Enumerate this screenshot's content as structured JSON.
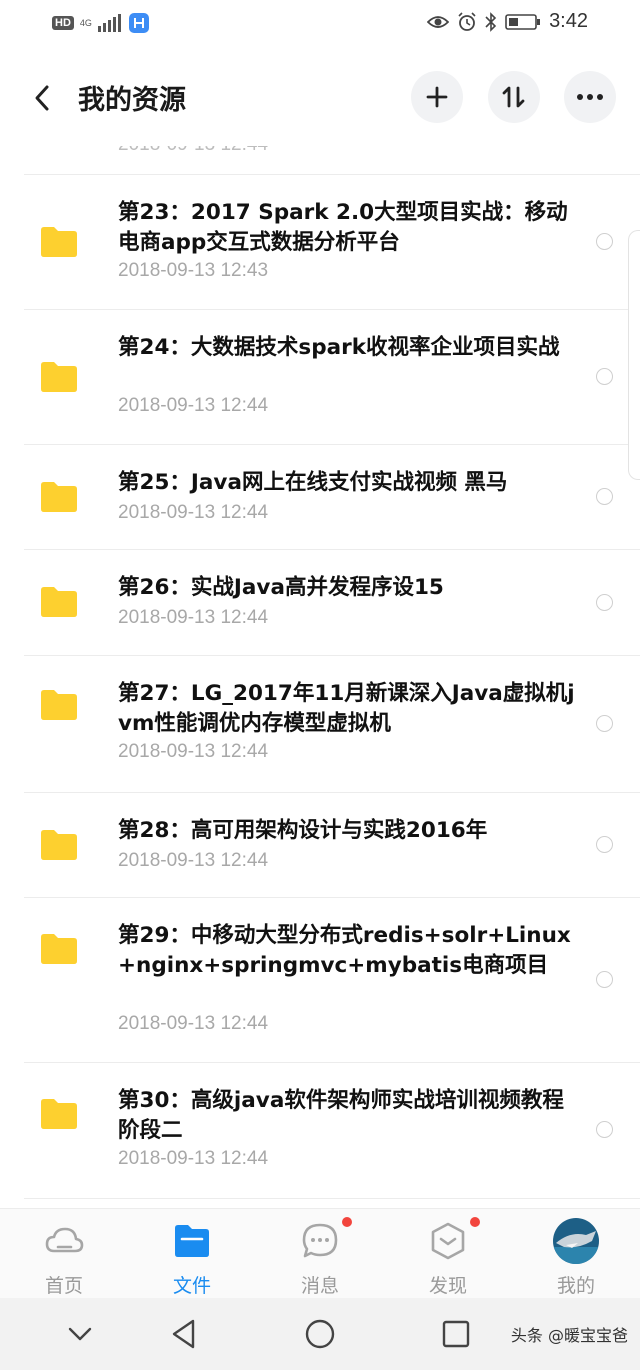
{
  "status_bar": {
    "hd_badge": "HD",
    "network": "4G",
    "time": "3:42",
    "icons": [
      "signal-icon",
      "app-icon",
      "eye-icon",
      "alarm-icon",
      "bluetooth-icon",
      "battery-icon"
    ]
  },
  "header": {
    "title": "我的资源",
    "icons": [
      "back-icon",
      "add-icon",
      "sort-icon",
      "more-icon"
    ]
  },
  "list": {
    "peek_date": "2018-09-13  12:44",
    "items": [
      {
        "name": "第23：2017 Spark 2.0大型项目实战：移动电商app交互式数据分析平台",
        "date": "2018-09-13  12:43"
      },
      {
        "name": "第24：大数据技术spark收视率企业项目实战",
        "date": "2018-09-13  12:44"
      },
      {
        "name": "第25：Java网上在线支付实战视频 黑马",
        "date": "2018-09-13  12:44"
      },
      {
        "name": "第26：实战Java高并发程序设15",
        "date": "2018-09-13  12:44"
      },
      {
        "name": "第27：LG_2017年11月新课深入Java虚拟机jvm性能调优内存模型虚拟机",
        "date": "2018-09-13  12:44"
      },
      {
        "name": "第28：高可用架构设计与实践2016年",
        "date": "2018-09-13  12:44"
      },
      {
        "name": "第29：中移动大型分布式redis+solr+Linux+nginx+springmvc+mybatis电商项目",
        "date": "2018-09-13  12:44"
      },
      {
        "name": "第30：高级java软件架构师实战培训视频教程阶段二",
        "date": "2018-09-13  12:44"
      }
    ]
  },
  "bottom_nav": {
    "items": [
      {
        "label": "首页",
        "icon": "cloud-icon",
        "active": false
      },
      {
        "label": "文件",
        "icon": "folder-icon",
        "active": true
      },
      {
        "label": "消息",
        "icon": "chat-icon",
        "active": false
      },
      {
        "label": "发现",
        "icon": "discover-icon",
        "active": false
      },
      {
        "label": "我的",
        "icon": "avatar",
        "active": false
      }
    ]
  },
  "colors": {
    "accent": "#1a8cf0",
    "folder": "#fdd02f",
    "badge": "#f2453d"
  },
  "watermark": "头条 @暖宝宝爸"
}
